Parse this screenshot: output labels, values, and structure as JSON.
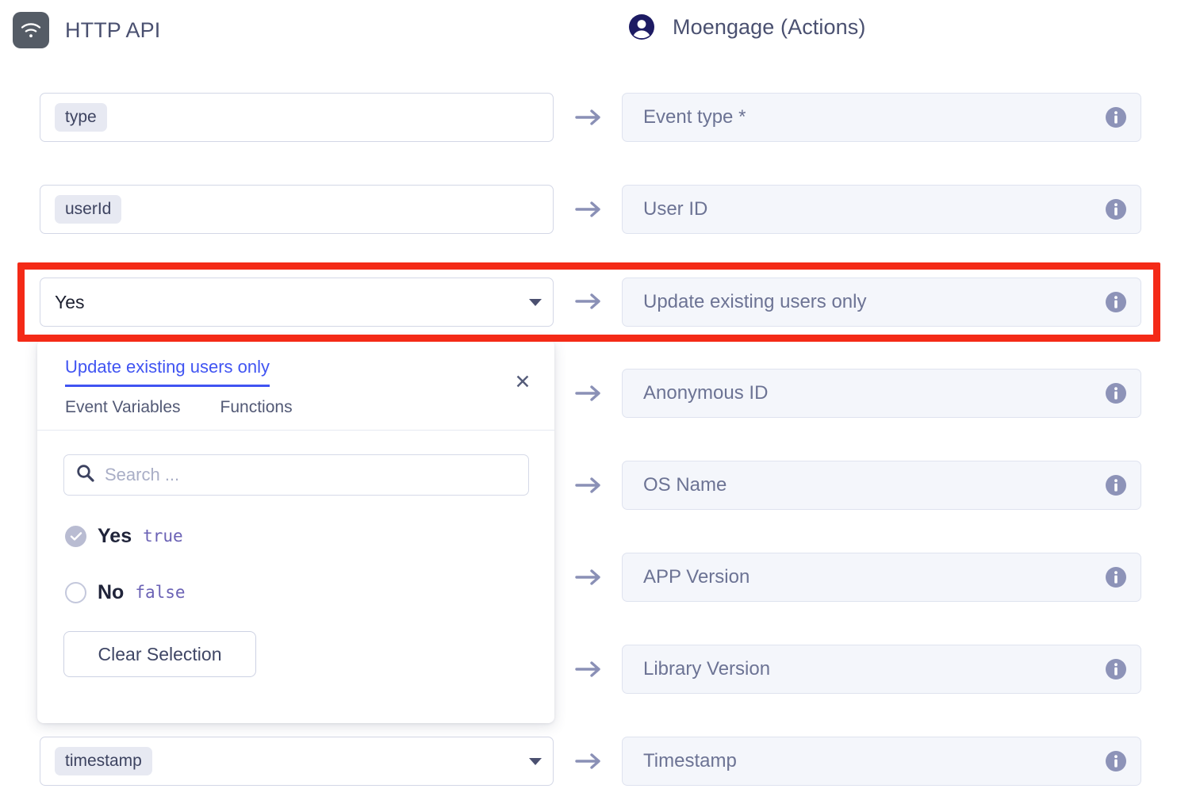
{
  "headers": {
    "left": {
      "title": "HTTP API",
      "icon": "wifi-icon"
    },
    "right": {
      "title": "Moengage (Actions)",
      "icon": "moengage-avatar-icon"
    }
  },
  "colors": {
    "accent_blue": "#4054f2",
    "highlight_red": "#f42a17",
    "token_bg": "#e7e9f2",
    "right_field_bg": "#f4f6fb",
    "arrow": "#8a90b6",
    "info_icon": "#8d93b8",
    "mono_value": "#6b62b5"
  },
  "mapping_rows": [
    {
      "source": {
        "kind": "token",
        "text": "type",
        "has_caret": false
      },
      "target": {
        "label": "Event type *",
        "info": true
      }
    },
    {
      "source": {
        "kind": "token",
        "text": "userId",
        "has_caret": false
      },
      "target": {
        "label": "User ID",
        "info": true
      }
    },
    {
      "source": {
        "kind": "value",
        "text": "Yes",
        "has_caret": true
      },
      "target": {
        "label": "Update existing users only",
        "info": true
      }
    },
    {
      "source": {
        "kind": "none",
        "text": "",
        "has_caret": false
      },
      "target": {
        "label": "Anonymous ID",
        "info": true
      }
    },
    {
      "source": {
        "kind": "none",
        "text": "",
        "has_caret": false
      },
      "target": {
        "label": "OS Name",
        "info": true
      }
    },
    {
      "source": {
        "kind": "none",
        "text": "",
        "has_caret": false
      },
      "target": {
        "label": "APP Version",
        "info": true
      }
    },
    {
      "source": {
        "kind": "none",
        "text": "",
        "has_caret": false
      },
      "target": {
        "label": "Library Version",
        "info": true
      }
    },
    {
      "source": {
        "kind": "token",
        "text": "timestamp",
        "has_caret": true
      },
      "target": {
        "label": "Timestamp",
        "info": true
      }
    }
  ],
  "dropdown": {
    "title_tab": "Update existing users only",
    "tabs": [
      "Event Variables",
      "Functions"
    ],
    "close_label": "✕",
    "search": {
      "placeholder": "Search ...",
      "value": "",
      "icon": "search-icon"
    },
    "options": [
      {
        "label": "Yes",
        "value": "true",
        "selected": true
      },
      {
        "label": "No",
        "value": "false",
        "selected": false
      }
    ],
    "clear_button": "Clear Selection"
  }
}
